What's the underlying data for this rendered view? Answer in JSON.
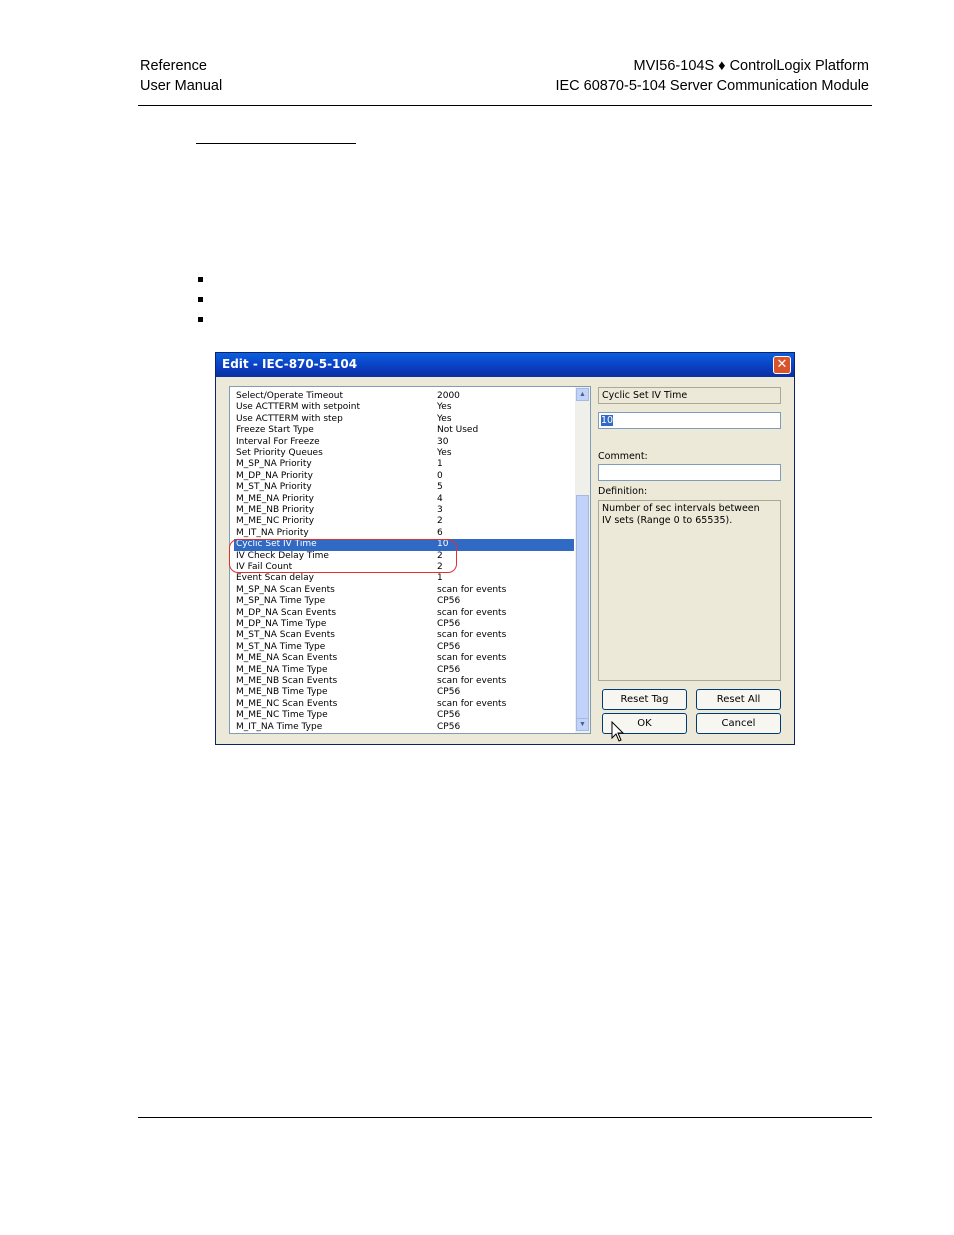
{
  "header": {
    "left_line1": "Reference",
    "left_line2": "User Manual",
    "right_line1": "MVI56-104S ♦ ControlLogix Platform",
    "right_line2": "IEC 60870-5-104 Server Communication Module"
  },
  "dialog": {
    "title": "Edit - IEC-870-5-104",
    "close_label": "✕",
    "rows": [
      {
        "key": "Select/Operate Timeout",
        "value": "2000"
      },
      {
        "key": "Use ACTTERM with setpoint",
        "value": "Yes"
      },
      {
        "key": "Use ACTTERM with step",
        "value": "Yes"
      },
      {
        "key": "Freeze Start Type",
        "value": "Not Used"
      },
      {
        "key": "Interval For Freeze",
        "value": "30"
      },
      {
        "key": "Set Priority Queues",
        "value": "Yes"
      },
      {
        "key": "M_SP_NA Priority",
        "value": "1"
      },
      {
        "key": "M_DP_NA Priority",
        "value": "0"
      },
      {
        "key": "M_ST_NA Priority",
        "value": "5"
      },
      {
        "key": "M_ME_NA Priority",
        "value": "4"
      },
      {
        "key": "M_ME_NB Priority",
        "value": "3"
      },
      {
        "key": "M_ME_NC Priority",
        "value": "2"
      },
      {
        "key": "M_IT_NA Priority",
        "value": "6"
      },
      {
        "key": "Cyclic Set IV Time",
        "value": "10"
      },
      {
        "key": "IV Check Delay Time",
        "value": "2"
      },
      {
        "key": "IV Fail Count",
        "value": "2"
      },
      {
        "key": "Event Scan delay",
        "value": "1"
      },
      {
        "key": "M_SP_NA Scan Events",
        "value": "scan for events"
      },
      {
        "key": "M_SP_NA Time Type",
        "value": "CP56"
      },
      {
        "key": "M_DP_NA Scan Events",
        "value": "scan for events"
      },
      {
        "key": "M_DP_NA Time Type",
        "value": "CP56"
      },
      {
        "key": "M_ST_NA Scan Events",
        "value": "scan for events"
      },
      {
        "key": "M_ST_NA Time Type",
        "value": "CP56"
      },
      {
        "key": "M_ME_NA Scan Events",
        "value": "scan for events"
      },
      {
        "key": "M_ME_NA Time Type",
        "value": "CP56"
      },
      {
        "key": "M_ME_NB Scan Events",
        "value": "scan for events"
      },
      {
        "key": "M_ME_NB Time Type",
        "value": "CP56"
      },
      {
        "key": "M_ME_NC Scan Events",
        "value": "scan for events"
      },
      {
        "key": "M_ME_NC Time Type",
        "value": "CP56"
      },
      {
        "key": "M_IT_NA Time Type",
        "value": "CP56"
      }
    ],
    "selected_row": 13,
    "tag_name": "Cyclic Set IV Time",
    "tag_value": "10",
    "comment_label": "Comment:",
    "comment_value": "",
    "definition_label": "Definition:",
    "definition_text": "Number of sec intervals between IV sets (Range 0 to 65535).",
    "buttons": {
      "reset_tag": "Reset Tag",
      "reset_all": "Reset All",
      "ok": "OK",
      "cancel": "Cancel"
    },
    "colors": {
      "selection": "#316ac5",
      "highlight_oval": "#e03030",
      "title_bar": "#0a3dbf"
    }
  }
}
